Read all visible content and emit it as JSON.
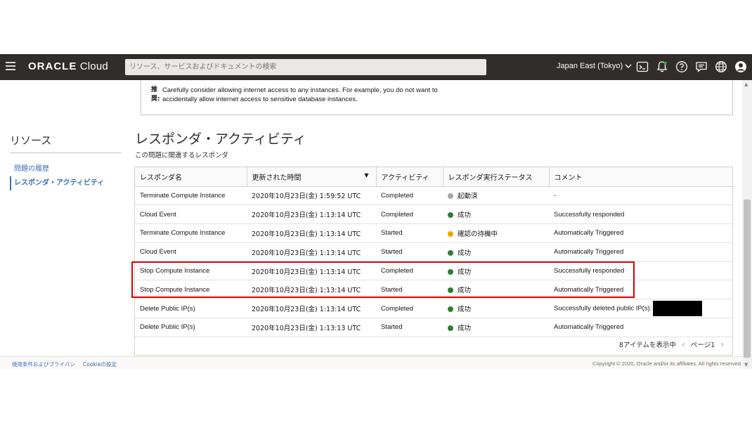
{
  "header": {
    "logo_prefix": "ORACLE",
    "logo_suffix": " Cloud",
    "search_placeholder": "リソース、サービスおよびドキュメントの検索",
    "region": "Japan East (Tokyo)",
    "icons": [
      "hamburger-menu-icon",
      "cloud-shell-icon",
      "bell-icon",
      "help-icon",
      "chat-icon",
      "globe-icon",
      "user-icon"
    ]
  },
  "notice": {
    "mark_line1": "推",
    "mark_line2": "奨:",
    "line1": "Carefully consider allowing internet access to any instances. For example, you do not want to",
    "line2": "accidentally allow internet access to sensitive database instances."
  },
  "sidebar": {
    "title": "リソース",
    "items": [
      {
        "label": "問題の履歴",
        "active": false
      },
      {
        "label": "レスポンダ・アクティビティ",
        "active": true
      }
    ]
  },
  "main": {
    "title": "レスポンダ・アクティビティ",
    "subtitle": "この問題に関連するレスポンダ",
    "columns": [
      "レスポンダ名",
      "更新された時間",
      "アクティビティ",
      "レスポンダ実行ステータス",
      "コメント"
    ],
    "rows": [
      {
        "name": "Terminate Compute Instance",
        "time": "2020年10月23日(金) 1:59:52 UTC",
        "activity": "Completed",
        "status": "起動済",
        "status_color": "#a8a8a8",
        "comment": "-"
      },
      {
        "name": "Cloud Event",
        "time": "2020年10月23日(金) 1:13:14 UTC",
        "activity": "Completed",
        "status": "成功",
        "status_color": "#2e7d32",
        "comment": "Successfully responded"
      },
      {
        "name": "Terminate Compute Instance",
        "time": "2020年10月23日(金) 1:13:14 UTC",
        "activity": "Started",
        "status": "確認の待機中",
        "status_color": "#f0a400",
        "comment": "Automatically Triggered"
      },
      {
        "name": "Cloud Event",
        "time": "2020年10月23日(金) 1:13:14 UTC",
        "activity": "Started",
        "status": "成功",
        "status_color": "#2e7d32",
        "comment": "Automatically Triggered"
      },
      {
        "name": "Stop Compute Instance",
        "time": "2020年10月23日(金) 1:13:14 UTC",
        "activity": "Completed",
        "status": "成功",
        "status_color": "#2e7d32",
        "comment": "Successfully responded"
      },
      {
        "name": "Stop Compute Instance",
        "time": "2020年10月23日(金) 1:13:14 UTC",
        "activity": "Started",
        "status": "成功",
        "status_color": "#2e7d32",
        "comment": "Automatically Triggered"
      },
      {
        "name": "Delete Public IP(s)",
        "time": "2020年10月23日(金) 1:13:14 UTC",
        "activity": "Completed",
        "status": "成功",
        "status_color": "#2e7d32",
        "comment": "Successfully deleted public IP(s):",
        "redacted": true
      },
      {
        "name": "Delete Public IP(s)",
        "time": "2020年10月23日(金) 1:13:13 UTC",
        "activity": "Started",
        "status": "成功",
        "status_color": "#2e7d32",
        "comment": "Automatically Triggered"
      }
    ],
    "pager_count": "8アイテムを表示中",
    "pager_page": "ページ1"
  },
  "footer": {
    "terms": "使用条件およびプライバシ",
    "cookie": "Cookieの設定",
    "copyright": "Copyright © 2020, Oracle and/or its affiliates. All rights reserved."
  },
  "colors": {
    "topbar": "#312d2a",
    "link": "#3b6fb6",
    "highlight": "#d80000"
  }
}
